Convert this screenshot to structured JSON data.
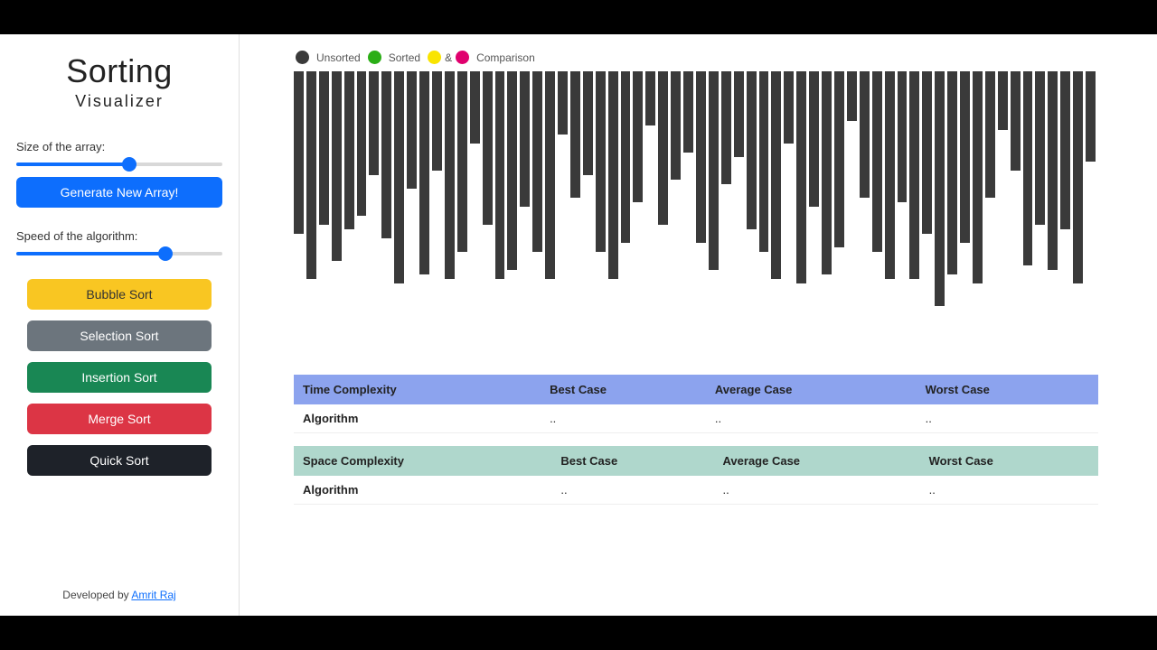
{
  "header": {
    "title_main": "Sorting",
    "title_sub": "Visualizer"
  },
  "controls": {
    "size_label": "Size of the array:",
    "size_value": 55,
    "size_min": 0,
    "size_max": 100,
    "generate_label": "Generate New Array!",
    "speed_label": "Speed of the algorithm:",
    "speed_value": 74,
    "speed_min": 0,
    "speed_max": 100
  },
  "algorithms": {
    "bubble": "Bubble Sort",
    "selection": "Selection Sort",
    "insertion": "Insertion Sort",
    "merge": "Merge Sort",
    "quick": "Quick Sort"
  },
  "credit": {
    "prefix": "Developed by ",
    "author": "Amrit Raj"
  },
  "legend": {
    "unsorted": {
      "label": "Unsorted",
      "color": "#3a3a3a"
    },
    "sorted": {
      "label": "Sorted",
      "color": "#2BAE16"
    },
    "comp1": {
      "color": "#F9E400"
    },
    "amp": {
      "label": "&"
    },
    "comp2": {
      "color": "#E0006E"
    },
    "comparison_label": "Comparison"
  },
  "tables": {
    "time": {
      "title": "Time Complexity",
      "headers": [
        "Best Case",
        "Average Case",
        "Worst Case"
      ],
      "row_label": "Algorithm",
      "row_values": [
        "..",
        "..",
        ".."
      ]
    },
    "space": {
      "title": "Space Complexity",
      "headers": [
        "Best Case",
        "Average Case",
        "Worst Case"
      ],
      "row_label": "Algorithm",
      "row_values": [
        "..",
        "..",
        ".."
      ]
    }
  },
  "chart_data": {
    "type": "bar",
    "title": "",
    "xlabel": "",
    "ylabel": "",
    "ylim": [
      0,
      280
    ],
    "color_unsorted": "#3a3a3a",
    "values": [
      180,
      230,
      170,
      210,
      175,
      160,
      115,
      185,
      235,
      130,
      225,
      110,
      230,
      200,
      80,
      170,
      230,
      220,
      150,
      200,
      230,
      70,
      140,
      115,
      200,
      230,
      190,
      145,
      60,
      170,
      120,
      90,
      190,
      220,
      125,
      95,
      175,
      200,
      230,
      80,
      235,
      150,
      225,
      195,
      55,
      140,
      200,
      230,
      145,
      230,
      180,
      260,
      225,
      190,
      235,
      140,
      65,
      110,
      215,
      170,
      220,
      175,
      235,
      100
    ]
  }
}
